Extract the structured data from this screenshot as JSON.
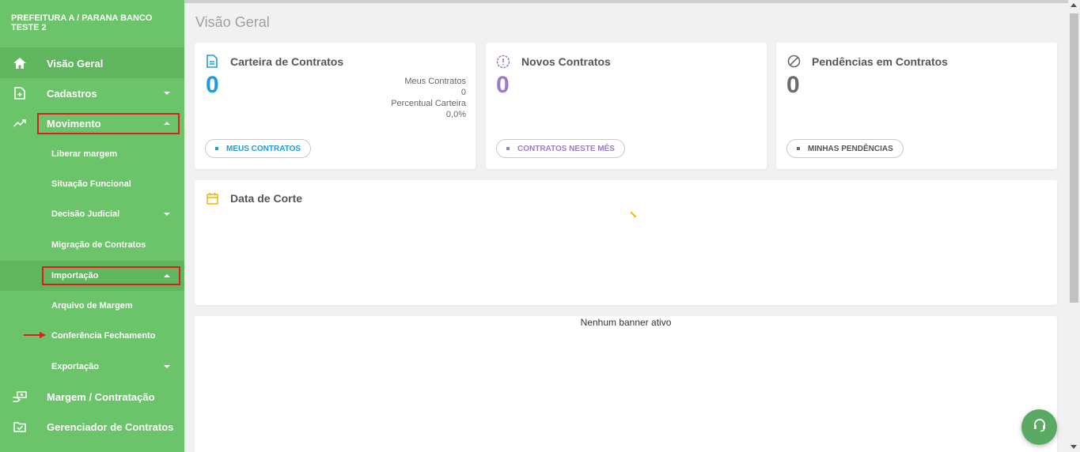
{
  "brand": "PREFEITURA A / PARANA BANCO TESTE 2",
  "sidebar": {
    "items": [
      {
        "label": "Visão Geral"
      },
      {
        "label": "Cadastros"
      },
      {
        "label": "Movimento"
      },
      {
        "label": "Liberar margem"
      },
      {
        "label": "Situação Funcional"
      },
      {
        "label": "Decisão Judicial"
      },
      {
        "label": "Migração de Contratos"
      },
      {
        "label": "Importação"
      },
      {
        "label": "Arquivo de Margem"
      },
      {
        "label": "Conferência Fechamento"
      },
      {
        "label": "Exportação"
      },
      {
        "label": "Margem / Contratação"
      },
      {
        "label": "Gerenciador de Contratos"
      }
    ]
  },
  "page_title": "Visão Geral",
  "cards": {
    "carteira": {
      "title": "Carteira de Contratos",
      "value": "0",
      "meus_label": "Meus Contratos",
      "meus_value": "0",
      "perc_label": "Percentual Carteira",
      "perc_value": "0,0%",
      "button": "MEUS CONTRATOS",
      "color": "#1e9be0"
    },
    "novos": {
      "title": "Novos Contratos",
      "value": "0",
      "button": "CONTRATOS NESTE MÊS",
      "color": "#9b7cc9"
    },
    "pendencias": {
      "title": "Pendências em Contratos",
      "value": "0",
      "button": "MINHAS PENDÊNCIAS",
      "color": "#6b6b6b"
    }
  },
  "data_corte": {
    "title": "Data de Corte",
    "color": "#f2b600"
  },
  "banner": {
    "text": "Nenhum banner ativo"
  },
  "colors": {
    "sidebar": "#6cc46a",
    "highlight": "#e01b1b",
    "support": "#5aaa63"
  }
}
